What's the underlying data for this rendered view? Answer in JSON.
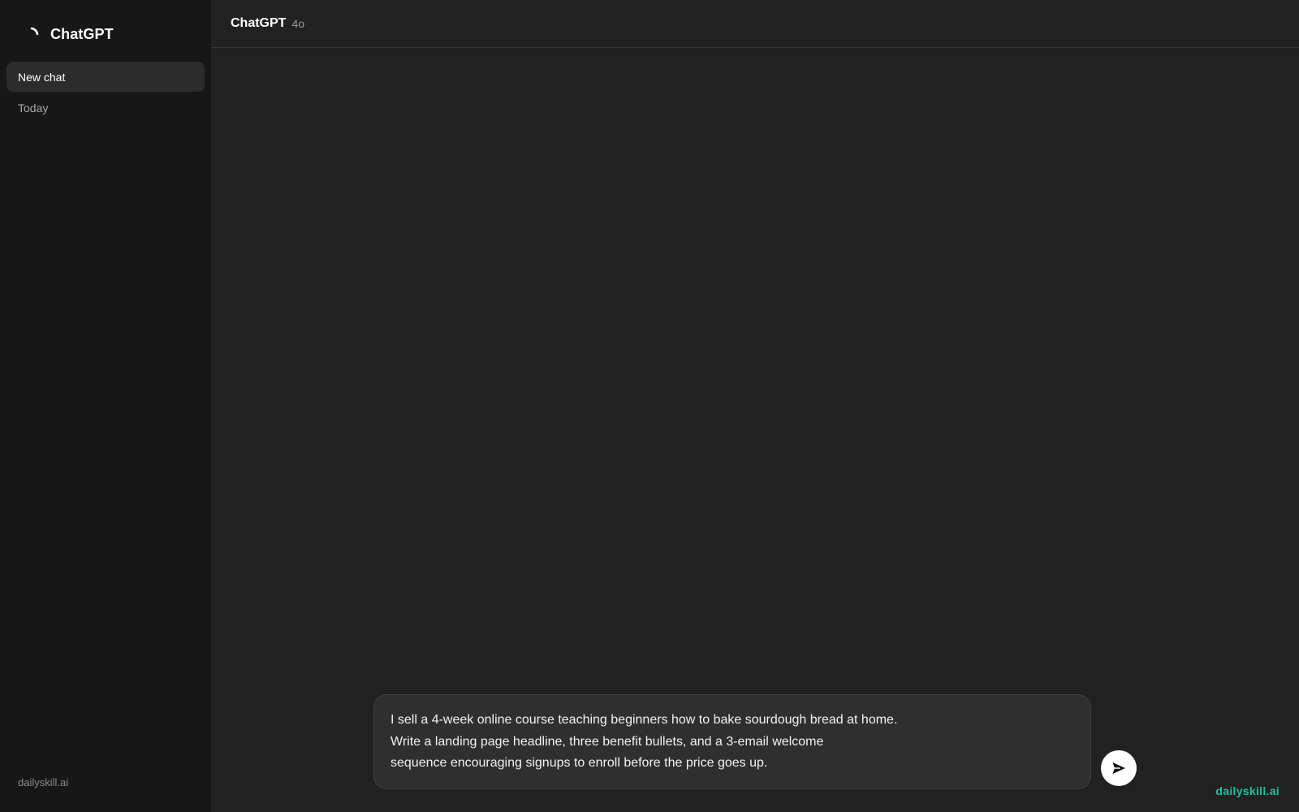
{
  "sidebar": {
    "brand_title": "ChatGPT",
    "new_chat_label": "New chat",
    "section_label": "Today",
    "footer_text": "dailyskill.ai"
  },
  "header": {
    "model_name": "ChatGPT",
    "model_version": "4o"
  },
  "composer": {
    "lines": [
      "I sell a 4-week online course teaching beginners how to bake sourdough bread at home.",
      "Write a landing page headline, three benefit bullets, and a 3-email welcome",
      "sequence encouraging signups to enroll before the price goes up."
    ]
  },
  "watermark": "dailyskill.ai",
  "icons": {
    "brand": "spinner-icon",
    "send": "send-arrow-icon"
  },
  "colors": {
    "sidebar_bg": "#171717",
    "main_bg": "#212121",
    "composer_bg": "#2f2f2f",
    "watermark": "#1fc0a1"
  }
}
